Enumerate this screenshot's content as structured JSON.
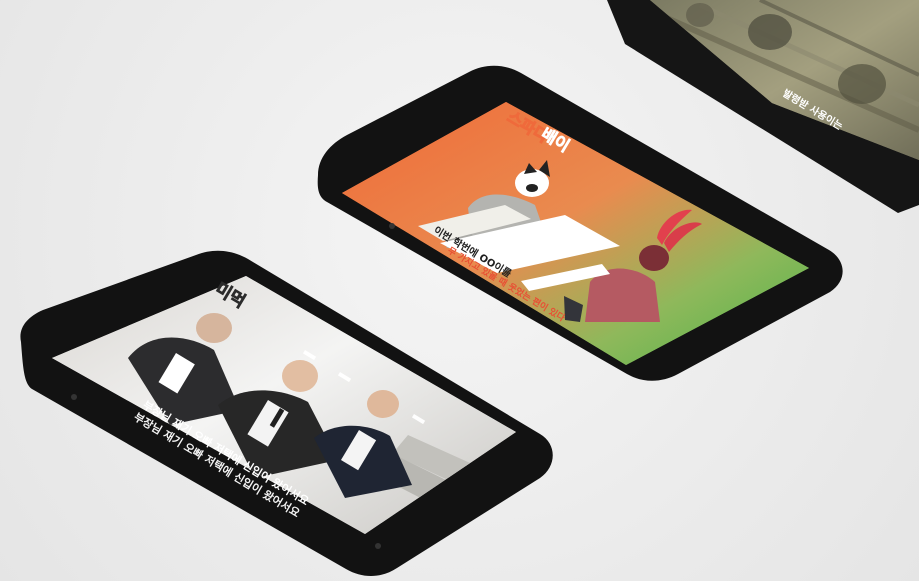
{
  "scene": {
    "background_color": "#ececec"
  },
  "phones": {
    "top_right": {
      "caption": "발령받 사용이는"
    },
    "center": {
      "show_logo_line1": "스파디",
      "show_logo_line2": "배이",
      "caption_line1": "이번 학번에 OO이를",
      "caption_line2": "무 가지고 있을 때 웃었는 편이 있다",
      "accent_orange": "#ee6a3b",
      "accent_green": "#4cb54a"
    },
    "left": {
      "logo": "미먹",
      "subtitle_line1": "부장님 재기 오빠 저택에 신입이 왔어서요",
      "subtitle_line2": "부장님 재기 오빠 저택에 신입이 왔어서요"
    }
  }
}
